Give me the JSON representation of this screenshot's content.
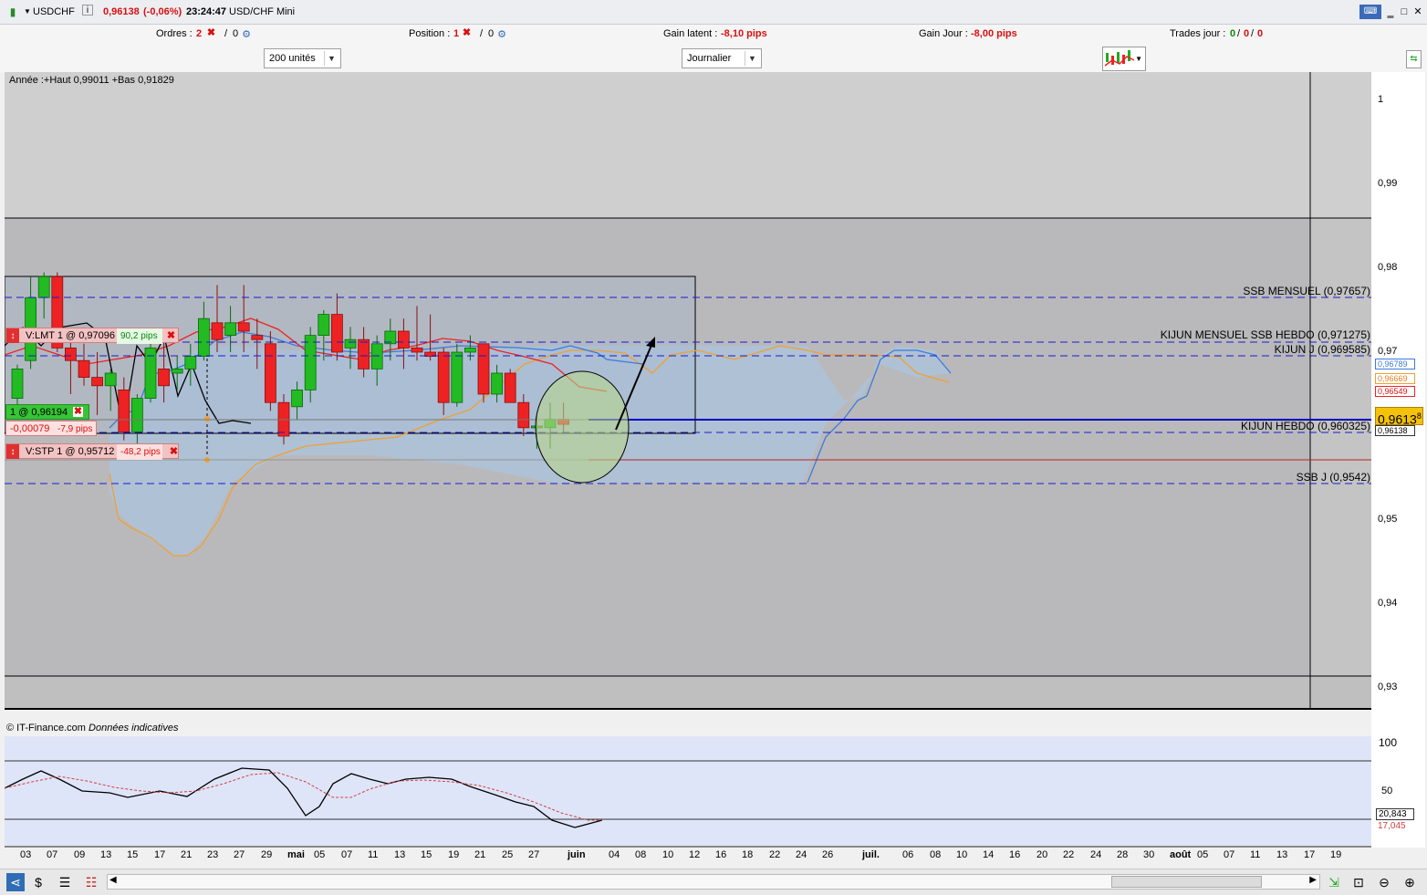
{
  "titlebar": {
    "symbol": "USDCHF",
    "price": "0,96138",
    "change": "(-0,06%)",
    "time": "23:24:47",
    "instrument": "USD/CHF Mini"
  },
  "infobar": {
    "ordres_label": "Ordres :",
    "ordres_count": "2",
    "ordres_sep": "/",
    "ordres_count2": "0",
    "position_label": "Position :",
    "position_count": "1",
    "position_sep": "/",
    "position_count2": "0",
    "gain_latent_label": "Gain latent :",
    "gain_latent_value": "-8,10 pips",
    "gain_jour_label": "Gain Jour :",
    "gain_jour_value": "-8,00 pips",
    "trades_label": "Trades jour :",
    "trades_value1": "0",
    "trades_value2": "0",
    "trades_value3": "0",
    "trades_sep": "/"
  },
  "controls": {
    "units_select": "200 unités",
    "period_select": "Journalier"
  },
  "chart": {
    "header": "Année :+Haut 0,99011 +Bas 0,91829",
    "copyright": "© IT-Finance.com",
    "disclaimer": "Données indicatives",
    "orders": {
      "limit_label": "V:LMT  1 @ 0,97096",
      "limit_pips": "90,2 pips",
      "position_label": "1 @ 0,96194",
      "position_diff": "-0,00079",
      "position_pips": "-7,9 pips",
      "stop_label": "V:STP  1 @ 0,95712",
      "stop_pips": "-48,2 pips"
    },
    "levels": {
      "ssb_mensuel": "SSB MENSUEL (0,97657)",
      "kijun_mensuel": "KIJUN MENSUEL SSB HEBDO (0,971275)",
      "kijun_j": "KIJUN J (0,969585)",
      "kijun_hebdo": "KIJUN HEBDO (0,960325)",
      "ssb_j": "SSB J (0,9542)"
    },
    "price_labels": [
      "0,96789",
      "0,96669",
      "0,96549",
      "0,96138"
    ],
    "current_price": "0,9613",
    "current_price_sup": "8",
    "colors": {
      "bull": "#22bb22",
      "bear": "#ee2222",
      "kijun": "#ee2222",
      "tenkan": "#3a7be0",
      "ssa": "#f0a030",
      "ssb_cloud": "#a8c8e8"
    },
    "yaxis": [
      "1",
      "0,99",
      "0,98",
      "0,97",
      "0,95",
      "0,94",
      "0,93"
    ],
    "xaxis": [
      "03",
      "07",
      "09",
      "13",
      "15",
      "17",
      "21",
      "23",
      "27",
      "29",
      "mai",
      "05",
      "07",
      "11",
      "13",
      "15",
      "19",
      "21",
      "25",
      "27",
      "juin",
      "04",
      "08",
      "10",
      "12",
      "16",
      "18",
      "22",
      "24",
      "26",
      "juil.",
      "06",
      "08",
      "10",
      "14",
      "16",
      "20",
      "22",
      "24",
      "28",
      "30",
      "août",
      "05",
      "07",
      "11",
      "13",
      "17",
      "19"
    ],
    "oscillator": {
      "levels": [
        "100",
        "50"
      ],
      "value1": "20,843",
      "value2": "17,045"
    }
  },
  "chart_data": {
    "type": "candlestick",
    "title": "USDCHF",
    "period": "Journalier",
    "ylim": [
      0.925,
      1.005
    ],
    "candles": [
      {
        "o": 0.9645,
        "h": 0.9685,
        "l": 0.9635,
        "c": 0.968
      },
      {
        "o": 0.969,
        "h": 0.979,
        "l": 0.968,
        "c": 0.9765
      },
      {
        "o": 0.9765,
        "h": 0.9795,
        "l": 0.974,
        "c": 0.979
      },
      {
        "o": 0.979,
        "h": 0.9795,
        "l": 0.97,
        "c": 0.9705
      },
      {
        "o": 0.9705,
        "h": 0.972,
        "l": 0.965,
        "c": 0.969
      },
      {
        "o": 0.969,
        "h": 0.971,
        "l": 0.966,
        "c": 0.967
      },
      {
        "o": 0.967,
        "h": 0.97,
        "l": 0.9625,
        "c": 0.966
      },
      {
        "o": 0.966,
        "h": 0.968,
        "l": 0.963,
        "c": 0.9675
      },
      {
        "o": 0.9655,
        "h": 0.967,
        "l": 0.9595,
        "c": 0.9605
      },
      {
        "o": 0.9605,
        "h": 0.965,
        "l": 0.959,
        "c": 0.9645
      },
      {
        "o": 0.9645,
        "h": 0.971,
        "l": 0.964,
        "c": 0.9705
      },
      {
        "o": 0.968,
        "h": 0.972,
        "l": 0.964,
        "c": 0.966
      },
      {
        "o": 0.9675,
        "h": 0.9695,
        "l": 0.9655,
        "c": 0.968
      },
      {
        "o": 0.968,
        "h": 0.971,
        "l": 0.966,
        "c": 0.9695
      },
      {
        "o": 0.9695,
        "h": 0.976,
        "l": 0.969,
        "c": 0.974
      },
      {
        "o": 0.9735,
        "h": 0.978,
        "l": 0.97,
        "c": 0.9715
      },
      {
        "o": 0.972,
        "h": 0.9755,
        "l": 0.97,
        "c": 0.9735
      },
      {
        "o": 0.9735,
        "h": 0.978,
        "l": 0.97,
        "c": 0.9725
      },
      {
        "o": 0.972,
        "h": 0.974,
        "l": 0.968,
        "c": 0.9715
      },
      {
        "o": 0.971,
        "h": 0.9725,
        "l": 0.963,
        "c": 0.964
      },
      {
        "o": 0.964,
        "h": 0.965,
        "l": 0.959,
        "c": 0.96
      },
      {
        "o": 0.9635,
        "h": 0.9665,
        "l": 0.962,
        "c": 0.9655
      },
      {
        "o": 0.9655,
        "h": 0.973,
        "l": 0.964,
        "c": 0.972
      },
      {
        "o": 0.972,
        "h": 0.975,
        "l": 0.969,
        "c": 0.9745
      },
      {
        "o": 0.9745,
        "h": 0.977,
        "l": 0.969,
        "c": 0.97
      },
      {
        "o": 0.9705,
        "h": 0.973,
        "l": 0.968,
        "c": 0.9715
      },
      {
        "o": 0.9715,
        "h": 0.973,
        "l": 0.967,
        "c": 0.968
      },
      {
        "o": 0.968,
        "h": 0.972,
        "l": 0.966,
        "c": 0.971
      },
      {
        "o": 0.971,
        "h": 0.974,
        "l": 0.969,
        "c": 0.9725
      },
      {
        "o": 0.9725,
        "h": 0.974,
        "l": 0.968,
        "c": 0.9705
      },
      {
        "o": 0.9705,
        "h": 0.9755,
        "l": 0.969,
        "c": 0.97
      },
      {
        "o": 0.97,
        "h": 0.9745,
        "l": 0.969,
        "c": 0.9695
      },
      {
        "o": 0.97,
        "h": 0.9705,
        "l": 0.9625,
        "c": 0.964
      },
      {
        "o": 0.964,
        "h": 0.971,
        "l": 0.9635,
        "c": 0.97
      },
      {
        "o": 0.97,
        "h": 0.972,
        "l": 0.969,
        "c": 0.9705
      },
      {
        "o": 0.971,
        "h": 0.971,
        "l": 0.964,
        "c": 0.965
      },
      {
        "o": 0.965,
        "h": 0.9685,
        "l": 0.964,
        "c": 0.9675
      },
      {
        "o": 0.9675,
        "h": 0.968,
        "l": 0.964,
        "c": 0.964
      },
      {
        "o": 0.964,
        "h": 0.965,
        "l": 0.96,
        "c": 0.961
      },
      {
        "o": 0.961,
        "h": 0.9625,
        "l": 0.9585,
        "c": 0.9612
      },
      {
        "o": 0.961,
        "h": 0.964,
        "l": 0.9585,
        "c": 0.962
      },
      {
        "o": 0.962,
        "h": 0.964,
        "l": 0.9605,
        "c": 0.9614
      }
    ]
  }
}
